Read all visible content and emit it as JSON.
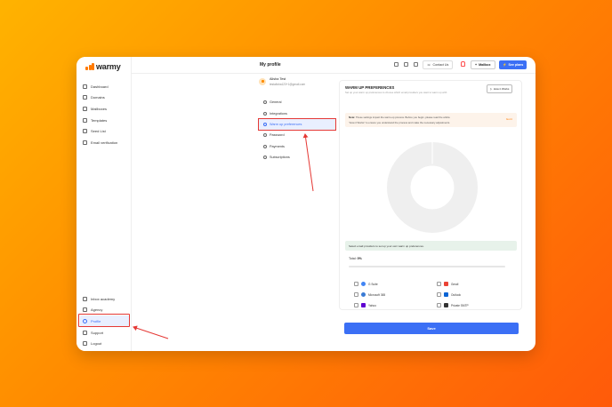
{
  "app": {
    "brand": "warmy",
    "page_title": "My profile"
  },
  "sidebar": {
    "items": [
      {
        "label": "Dashboard",
        "icon": "dashboard-icon"
      },
      {
        "label": "Domains",
        "icon": "globe-icon"
      },
      {
        "label": "Mailboxes",
        "icon": "mailbox-icon"
      },
      {
        "label": "Templates",
        "icon": "template-icon"
      },
      {
        "label": "Seed List",
        "icon": "list-icon"
      },
      {
        "label": "Email verification",
        "icon": "verify-icon"
      }
    ],
    "bottom_items": [
      {
        "label": "Inbox academy",
        "icon": "academy-icon"
      },
      {
        "label": "Agency",
        "icon": "agency-icon"
      },
      {
        "label": "Profile",
        "icon": "user-icon",
        "active": true
      },
      {
        "label": "Support",
        "icon": "support-icon"
      },
      {
        "label": "Logout",
        "icon": "logout-icon"
      }
    ]
  },
  "topbar": {
    "contact_label": "Contact Us",
    "mailbox_label": "Mailbox",
    "plans_label": "See plans"
  },
  "profile": {
    "name": "Alisha Test",
    "email": "testalisha123+1@gmail.com",
    "menu": [
      {
        "label": "General"
      },
      {
        "label": "Integrations"
      },
      {
        "label": "Warm up preferences",
        "active": true
      },
      {
        "label": "Password"
      },
      {
        "label": "Payments"
      },
      {
        "label": "Subscriptions"
      }
    ]
  },
  "warmup": {
    "title": "WARM UP PREFERENCES",
    "subtitle": "Set up your warm up preferences to choose which email providers you want to warm up with",
    "how_it_works_label": "How it Works",
    "note_label": "Note:",
    "note_text": "These settings impact the warm-up process. Before you begin, please read the article",
    "note_text2": "\"How it Works\" to ensure you understand the process and make the necessary adjustments.",
    "note_link": "Got it",
    "provider_prompt": "Select email providers to set up your own warm up preferences.",
    "total_label": "Total:",
    "total_value": "0%",
    "total_percent": 0,
    "providers": [
      {
        "name": "G Suite",
        "icon": "google-icon",
        "color": "#4285f4",
        "checked": false
      },
      {
        "name": "Gmail",
        "icon": "gmail-icon",
        "color": "#ea4335",
        "checked": false
      },
      {
        "name": "Microsoft 365",
        "icon": "microsoft-icon",
        "color": "#3a7bd5",
        "checked": false
      },
      {
        "name": "Outlook",
        "icon": "outlook-icon",
        "color": "#0a64d4",
        "checked": false
      },
      {
        "name": "Yahoo",
        "icon": "yahoo-icon",
        "color": "#5f01d1",
        "checked": false
      },
      {
        "name": "Private SMTP",
        "icon": "envelope-icon",
        "color": "#333333",
        "checked": false
      }
    ],
    "save_label": "Save"
  },
  "colors": {
    "accent": "#3b6ff5",
    "brand": "#ff7a00",
    "highlight": "#e53935"
  }
}
